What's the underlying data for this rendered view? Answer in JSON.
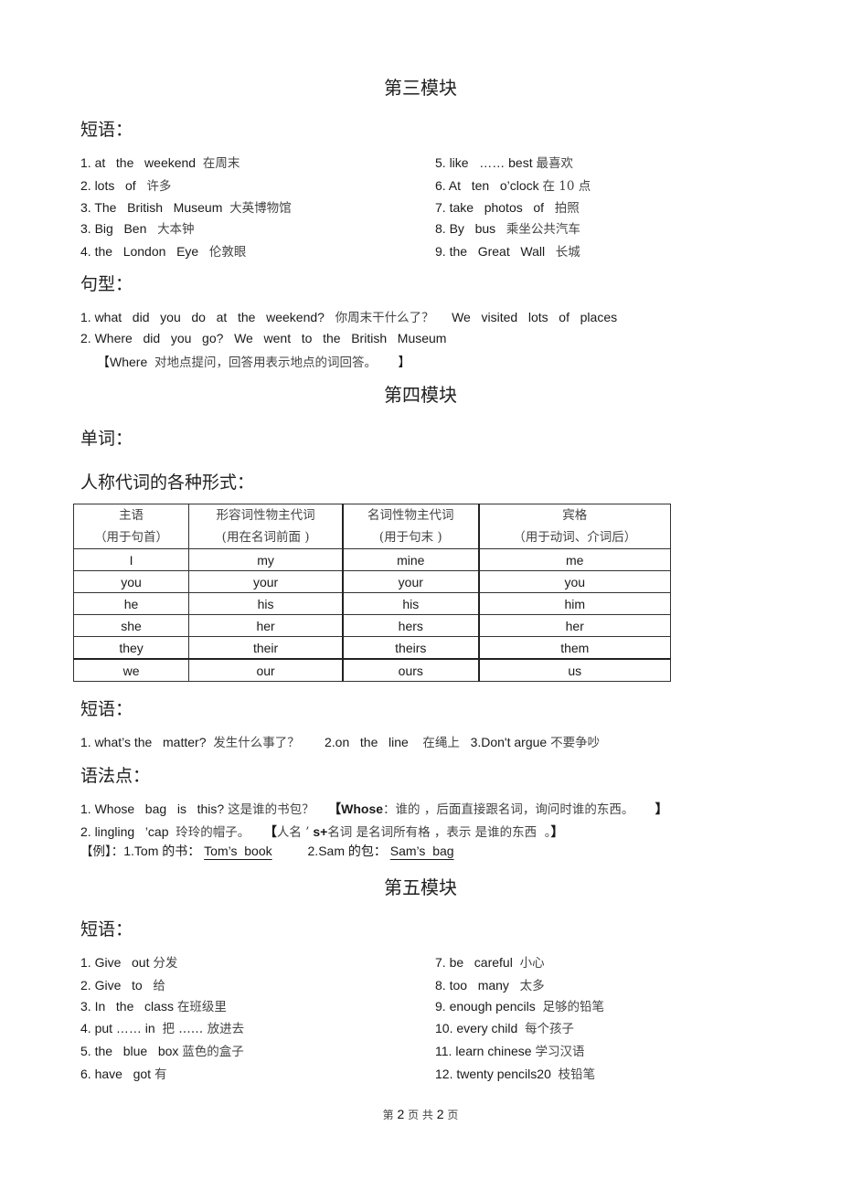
{
  "module3": {
    "title": "第三模块",
    "phrases_heading": "短语：",
    "phrases_left": [
      {
        "en": "1. at   the   weekend",
        "cn": "在周末"
      },
      {
        "en": "2. lots   of",
        "cn": "许多"
      },
      {
        "en": "3. The   British   Museum",
        "cn": "大英博物馆"
      },
      {
        "en": "3. Big   Ben",
        "cn": "大本钟"
      },
      {
        "en": "4. the   London   Eye",
        "cn": "伦敦眼"
      }
    ],
    "phrases_right": [
      {
        "en": "5. like   …… best",
        "cn": "最喜欢"
      },
      {
        "en": "6. At   ten   o’clock",
        "cn": "在 10 点"
      },
      {
        "en": "7. take   photos   of",
        "cn": "拍照"
      },
      {
        "en": "8. By   bus",
        "cn": "乘坐公共汽车"
      },
      {
        "en": "9. the   Great   Wall",
        "cn": "长城"
      }
    ],
    "sentences_heading": "句型：",
    "sentences": [
      {
        "en": "1. what   did   you   do   at   the   weekend?",
        "cn": "你周末干什么了？",
        "en2": "We   visited   lots   of   places"
      },
      {
        "en": "2. Where   did   you   go?   We   went   to   the   British   Museum"
      }
    ],
    "note": {
      "open": "【",
      "en": "Where",
      "cn": "对地点提问，回答用表示地点的词回答。",
      "close": "】"
    }
  },
  "module4": {
    "title": "第四模块",
    "words_heading": "单词：",
    "pronouns_heading": "人称代词的各种形式：",
    "table": {
      "headers": [
        {
          "line1": "主语",
          "line2": "（用于句首）"
        },
        {
          "line1": "形容词性物主代词",
          "line2": "(用在名词前面  )"
        },
        {
          "line1": "名词性物主代词",
          "line2": "(用于句末  )"
        },
        {
          "line1": "宾格",
          "line2": "（用于动词、介词后）"
        }
      ],
      "rows": [
        [
          "I",
          "my",
          "mine",
          "me"
        ],
        [
          "you",
          "your",
          "your",
          "you"
        ],
        [
          "he",
          "his",
          "his",
          "him"
        ],
        [
          "she",
          "her",
          "hers",
          "her"
        ],
        [
          "they",
          "their",
          "theirs",
          "them"
        ],
        [
          "we",
          "our",
          "ours",
          "us"
        ]
      ]
    },
    "phrases_heading": "短语：",
    "phrases": [
      {
        "en": "1. what’s the   matter?",
        "cn": "发生什么事了？"
      },
      {
        "en": "2.on   the   line",
        "cn": "在绳上"
      },
      {
        "en": "3.Don't argue",
        "cn": "不要争吵"
      }
    ],
    "grammar_heading": "语法点：",
    "grammar": {
      "line1": {
        "en": "1. Whose   bag   is   this?",
        "cn": "这是谁的书包？",
        "note_open": "【",
        "note_bold": "Whose",
        "note_cn": "：谁的 ，后面直接跟名词，询问时谁的东西。",
        "note_close": "】"
      },
      "line2": {
        "en": "2. lingling   ’cap",
        "cn": "玲玲的帽子。",
        "note_open": "【",
        "note_cn1": "人名 ’",
        "note_bold": "s+",
        "note_cn2": "名词 是名词所有格 ，表示 是谁的东西  。",
        "note_close": "】"
      },
      "example": {
        "label": "【例】：",
        "ex1_prefix": "1.Tom 的书：",
        "ex1_answer": "Tom’s  book",
        "ex2_prefix": "2.Sam 的包：",
        "ex2_answer": "Sam’s  bag"
      }
    }
  },
  "module5": {
    "title": "第五模块",
    "phrases_heading": "短语：",
    "phrases_left": [
      {
        "en": "1. Give   out",
        "cn": "分发"
      },
      {
        "en": "2. Give   to",
        "cn": "给"
      },
      {
        "en": "3. In   the   class",
        "cn": "在班级里"
      },
      {
        "en": "4. put …… in",
        "cn": "把 …… 放进去"
      },
      {
        "en": "5. the   blue   box",
        "cn": "蓝色的盒子"
      },
      {
        "en": "6. have   got",
        "cn": "有"
      }
    ],
    "phrases_right": [
      {
        "en": "7. be   careful",
        "cn": "小心"
      },
      {
        "en": "8. too   many",
        "cn": "太多"
      },
      {
        "en": "9. enough pencils",
        "cn": "足够的铅笔"
      },
      {
        "en": "10. every child",
        "cn": "每个孩子"
      },
      {
        "en": "11. learn chinese",
        "cn": "学习汉语"
      },
      {
        "en": "12. twenty pencils20",
        "cn": "枝铅笔"
      }
    ]
  },
  "footer": {
    "prefix": "第",
    "page": "2",
    "mid": "页 共",
    "total": "2",
    "suffix": "页"
  }
}
